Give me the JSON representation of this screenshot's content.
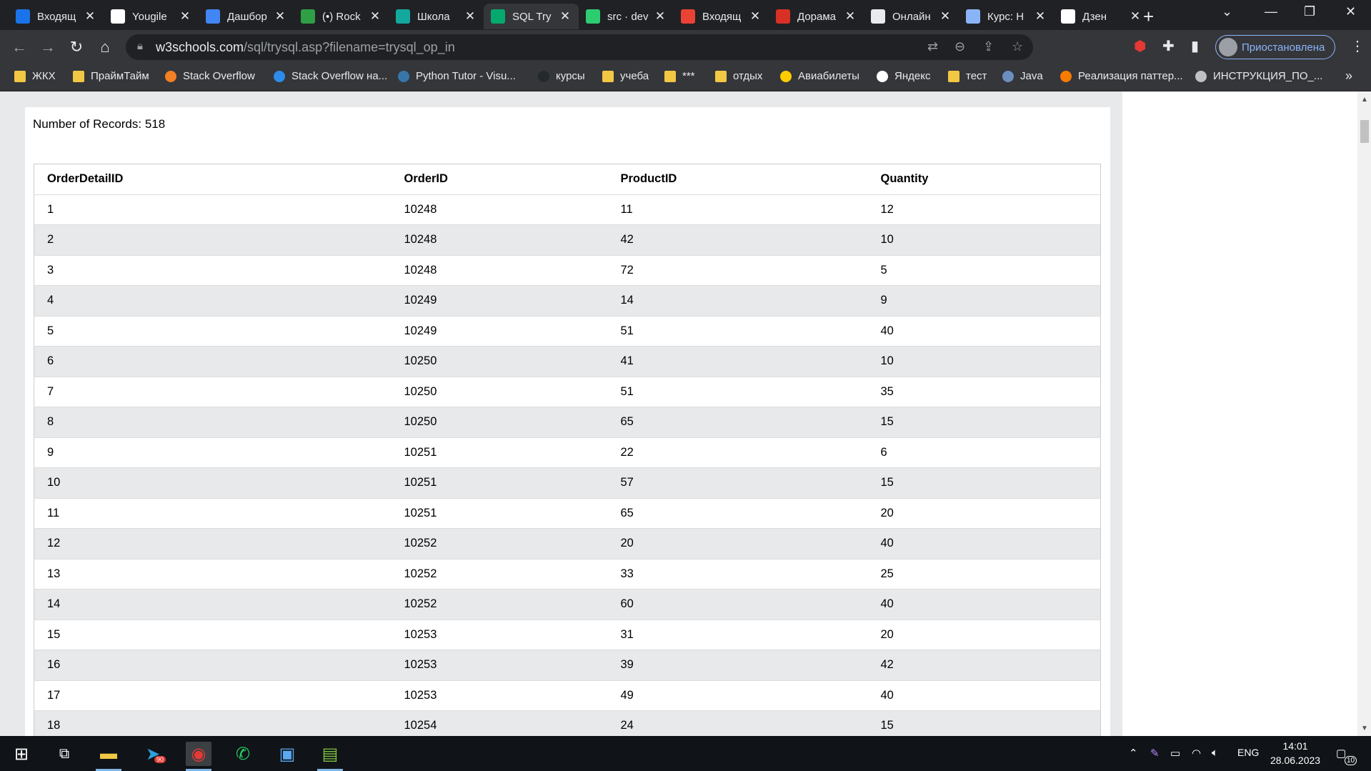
{
  "tabs": [
    {
      "title": "Входящ",
      "icon": "mail-icon",
      "color": "#1a73e8"
    },
    {
      "title": "Yougile",
      "icon": "yougile-icon",
      "color": "#ffffff"
    },
    {
      "title": "Дашбор",
      "icon": "dashboard-icon",
      "color": "#4285f4"
    },
    {
      "title": "(•) Rock",
      "icon": "rocketchat-icon",
      "color": "#2f9e44"
    },
    {
      "title": "Школа",
      "icon": "school-icon",
      "color": "#13a89e"
    },
    {
      "title": "SQL Try",
      "icon": "w3schools-icon",
      "color": "#04aa6d"
    },
    {
      "title": "src · dev",
      "icon": "gitlab-icon",
      "color": "#2ecc71"
    },
    {
      "title": "Входящ",
      "icon": "gmail-icon",
      "color": "#ea4335"
    },
    {
      "title": "Дорама",
      "icon": "doramalive-icon",
      "color": "#d93025"
    },
    {
      "title": "Онлайн",
      "icon": "online-icon",
      "color": "#e8eaed"
    },
    {
      "title": "Курс: Н",
      "icon": "course-icon",
      "color": "#8ab4f8"
    },
    {
      "title": "Дзен",
      "icon": "dzen-icon",
      "color": "#ffffff"
    }
  ],
  "address": {
    "host": "w3schools.com",
    "path": "/sql/trysql.asp?filename=trysql_op_in"
  },
  "profile": {
    "label": "Приостановлена"
  },
  "bookmarks": [
    {
      "label": "ЖКХ",
      "icon": "folder-icon"
    },
    {
      "label": "ПраймТайм",
      "icon": "folder-icon"
    },
    {
      "label": "Stack Overflow",
      "icon": "stackoverflow-icon"
    },
    {
      "label": "Stack Overflow на...",
      "icon": "stackoverflow-ru-icon"
    },
    {
      "label": "Python Tutor - Visu...",
      "icon": "python-icon"
    },
    {
      "label": "курсы",
      "icon": "github-icon"
    },
    {
      "label": "учеба",
      "icon": "folder-icon"
    },
    {
      "label": "***",
      "icon": "folder-icon"
    },
    {
      "label": "отдых",
      "icon": "folder-icon"
    },
    {
      "label": "Авиабилеты",
      "icon": "tickets-icon"
    },
    {
      "label": "Яндекс",
      "icon": "yandex-icon"
    },
    {
      "label": "тест",
      "icon": "folder-icon"
    },
    {
      "label": "Java",
      "icon": "java-icon"
    },
    {
      "label": "Реализация паттер...",
      "icon": "habr-icon"
    },
    {
      "label": "ИНСТРУКЦИЯ_ПО_...",
      "icon": "globe-icon"
    }
  ],
  "result": {
    "records_label": "Number of Records: 518",
    "columns": [
      "OrderDetailID",
      "OrderID",
      "ProductID",
      "Quantity"
    ],
    "rows": [
      [
        "1",
        "10248",
        "11",
        "12"
      ],
      [
        "2",
        "10248",
        "42",
        "10"
      ],
      [
        "3",
        "10248",
        "72",
        "5"
      ],
      [
        "4",
        "10249",
        "14",
        "9"
      ],
      [
        "5",
        "10249",
        "51",
        "40"
      ],
      [
        "6",
        "10250",
        "41",
        "10"
      ],
      [
        "7",
        "10250",
        "51",
        "35"
      ],
      [
        "8",
        "10250",
        "65",
        "15"
      ],
      [
        "9",
        "10251",
        "22",
        "6"
      ],
      [
        "10",
        "10251",
        "57",
        "15"
      ],
      [
        "11",
        "10251",
        "65",
        "20"
      ],
      [
        "12",
        "10252",
        "20",
        "40"
      ],
      [
        "13",
        "10252",
        "33",
        "25"
      ],
      [
        "14",
        "10252",
        "60",
        "40"
      ],
      [
        "15",
        "10253",
        "31",
        "20"
      ],
      [
        "16",
        "10253",
        "39",
        "42"
      ],
      [
        "17",
        "10253",
        "49",
        "40"
      ],
      [
        "18",
        "10254",
        "24",
        "15"
      ]
    ]
  },
  "taskbar": {
    "telegram_badge": "90",
    "lang": "ENG",
    "time": "14:01",
    "date": "28.06.2023",
    "notifications": "10"
  }
}
